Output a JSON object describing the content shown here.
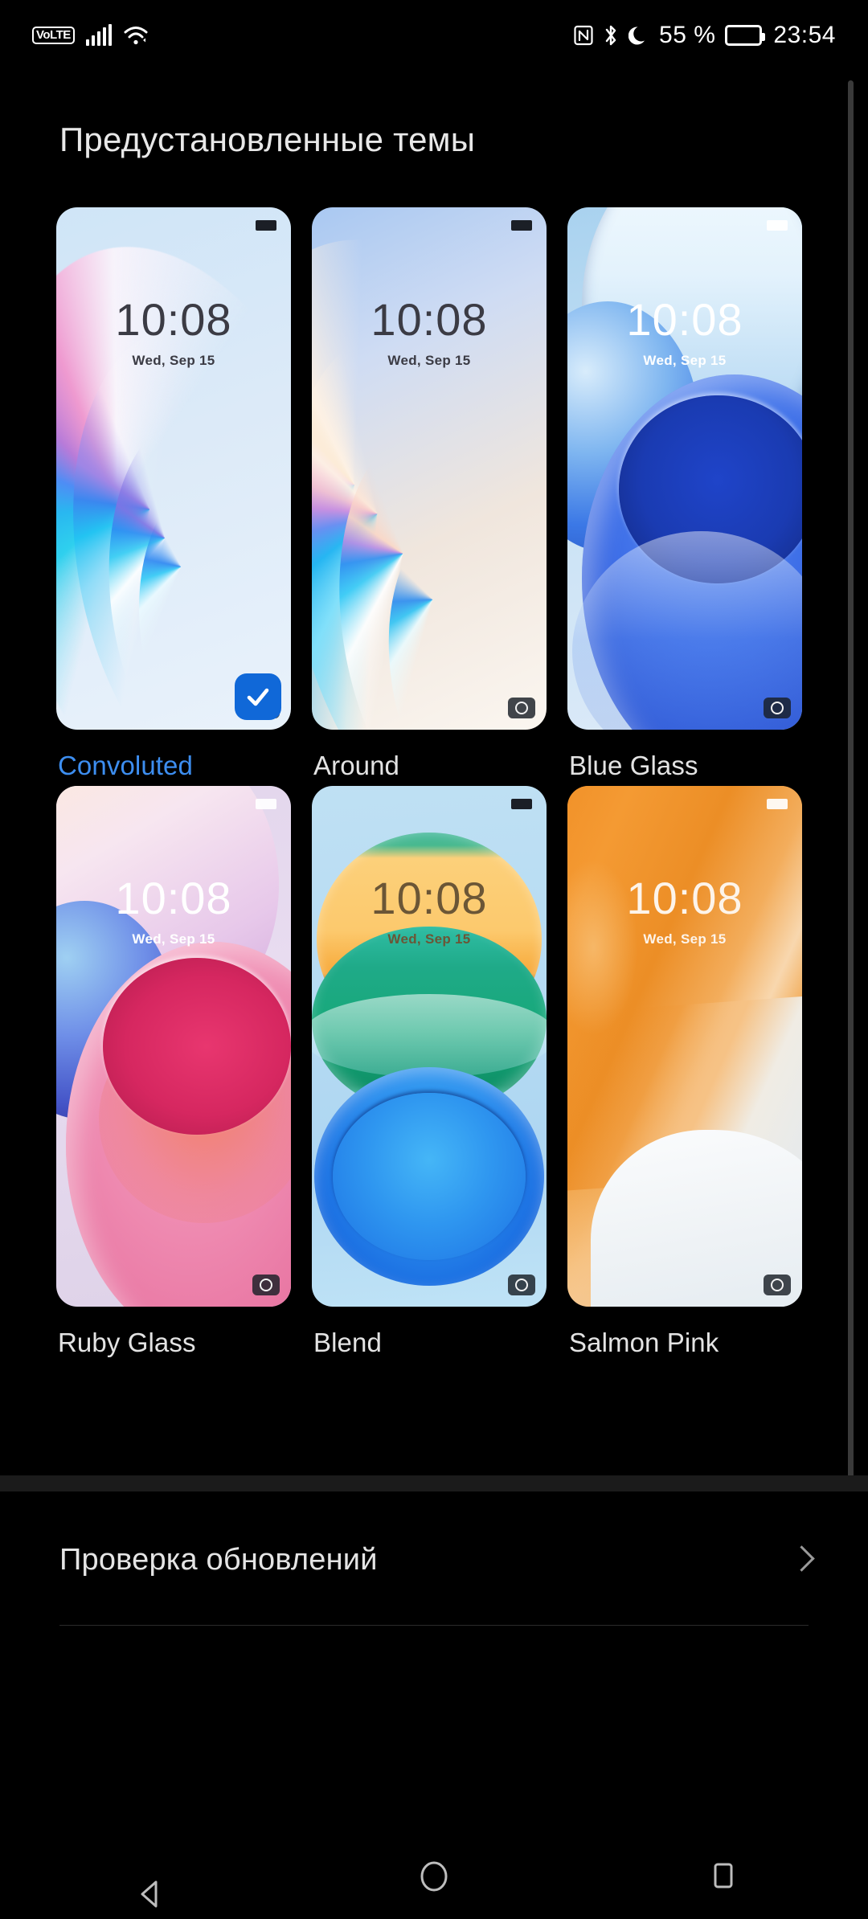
{
  "statusbar": {
    "volte": "VoLTE",
    "signal_icon": "signal-bars-icon",
    "wifi_icon": "wifi-icon",
    "nfc_icon": "nfc-icon",
    "bluetooth_icon": "bluetooth-icon",
    "dnd_icon": "moon-icon",
    "battery_percent": "55 %",
    "battery_icon": "battery-icon",
    "time": "23:54"
  },
  "page": {
    "title": "Предустановленные темы",
    "accent_color": "#3d8ef0",
    "background_color": "#000000"
  },
  "themes": [
    {
      "name": "Convoluted",
      "selected": true,
      "clock": "10:08",
      "date": "Wed, Sep 15",
      "clock_tone": "dark",
      "status_icon": "battery-icon",
      "status_tone": "dark",
      "badge_icon": "check-icon",
      "camera_icon": "camera-icon"
    },
    {
      "name": "Around",
      "selected": false,
      "clock": "10:08",
      "date": "Wed, Sep 15",
      "clock_tone": "dark",
      "status_icon": "battery-icon",
      "status_tone": "dark",
      "badge_icon": null,
      "camera_icon": "camera-icon"
    },
    {
      "name": "Blue Glass",
      "selected": false,
      "clock": "10:08",
      "date": "Wed, Sep 15",
      "clock_tone": "light",
      "status_icon": "battery-icon",
      "status_tone": "light",
      "badge_icon": null,
      "camera_icon": "camera-icon"
    },
    {
      "name": "Ruby Glass",
      "selected": false,
      "clock": "10:08",
      "date": "Wed, Sep 15",
      "clock_tone": "light",
      "status_icon": "battery-icon",
      "status_tone": "light",
      "badge_icon": null,
      "camera_icon": "camera-icon"
    },
    {
      "name": "Blend",
      "selected": false,
      "clock": "10:08",
      "date": "Wed, Sep 15",
      "clock_tone": "brown",
      "status_icon": "battery-icon",
      "status_tone": "dark",
      "badge_icon": null,
      "camera_icon": "camera-icon"
    },
    {
      "name": "Salmon Pink",
      "selected": false,
      "clock": "10:08",
      "date": "Wed, Sep 15",
      "clock_tone": "warm",
      "status_icon": "battery-icon",
      "status_tone": "light",
      "badge_icon": null,
      "camera_icon": "camera-icon"
    }
  ],
  "update_row": {
    "label": "Проверка обновлений",
    "chevron_icon": "chevron-right-icon"
  },
  "navbar": {
    "back_icon": "back-triangle-icon",
    "home_icon": "home-circle-icon",
    "recents_icon": "recents-square-icon"
  }
}
